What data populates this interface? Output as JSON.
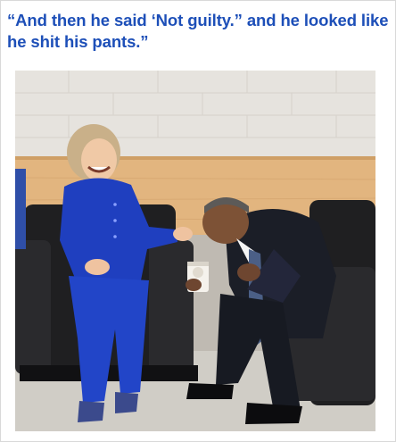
{
  "meme": {
    "caption": "“And then he said ‘Not guilty.” and he looked like he shit his pants.”"
  },
  "photo": {
    "subject": "woman in blue pantsuit laughing, seated in leather chair; man in dark suit bent over laughing holding a coffee cup",
    "colors": {
      "wall": "#e6e3de",
      "wood_panel": "#e2b57f",
      "floor": "#d0cdc6",
      "chair": "#1f1f21",
      "blue_suit": "#1f3fbf",
      "dark_suit": "#1b1e27"
    }
  }
}
